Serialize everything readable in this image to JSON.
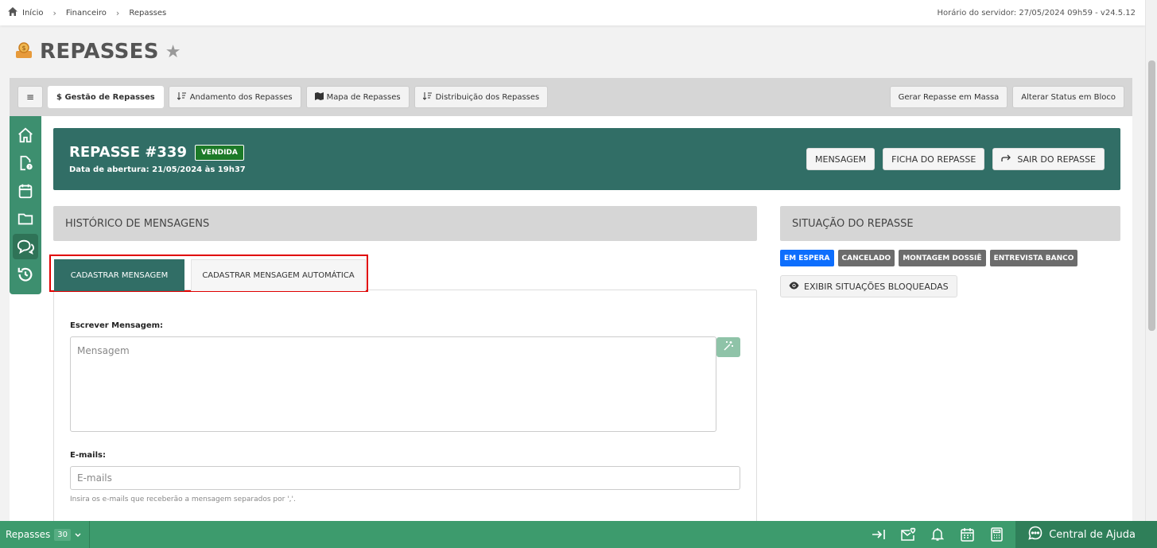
{
  "breadcrumb": {
    "home": "Início",
    "items": [
      "Financeiro",
      "Repasses"
    ]
  },
  "server_info": "Horário do servidor: 27/05/2024 09h59 - v24.5.12",
  "page": {
    "title": "REPASSES"
  },
  "tabs": {
    "menu_icon": "≡",
    "items": [
      {
        "label": "$ Gestão de Repasses",
        "active": true
      },
      {
        "label": "Andamento dos Repasses",
        "icon": "sort-icon"
      },
      {
        "label": "Mapa de Repasses",
        "icon": "map-icon"
      },
      {
        "label": "Distribuição dos Repasses",
        "icon": "sort-icon"
      }
    ],
    "right": [
      "Gerar Repasse em Massa",
      "Alterar Status em Bloco"
    ]
  },
  "repasse": {
    "title": "REPASSE #339",
    "status": "VENDIDA",
    "opened": "Data de abertura: 21/05/2024 às 19h37",
    "actions": {
      "message": "MENSAGEM",
      "sheet": "FICHA DO REPASSE",
      "exit": "SAIR DO REPASSE"
    }
  },
  "history": {
    "title": "HISTÓRICO DE MENSAGENS",
    "tabs": {
      "register": "CADASTRAR MENSAGEM",
      "auto": "CADASTRAR MENSAGEM AUTOMÁTICA"
    },
    "form": {
      "message_label": "Escrever Mensagem:",
      "message_placeholder": "Mensagem",
      "emails_label": "E-mails:",
      "emails_placeholder": "E-mails",
      "emails_hint": "Insira os e-mails que receberão a mensagem separados por ','."
    }
  },
  "situation": {
    "title": "SITUAÇÃO DO REPASSE",
    "badges": [
      {
        "label": "EM ESPERA",
        "color": "#0d6efd"
      },
      {
        "label": "CANCELADO",
        "color": "#6c6c6c"
      },
      {
        "label": "MONTAGEM DOSSIÊ",
        "color": "#6c6c6c"
      },
      {
        "label": "ENTREVISTA BANCO",
        "color": "#6c6c6c"
      }
    ],
    "show_blocked": "EXIBIR SITUAÇÕES BLOQUEADAS"
  },
  "bottom": {
    "label": "Repasses",
    "count": "30",
    "help": "Central de Ajuda"
  },
  "colors": {
    "primary": "#316e66",
    "sidebar": "#3d8f6f",
    "bottombar": "#3d9b6d",
    "highlight": "#e00000"
  }
}
